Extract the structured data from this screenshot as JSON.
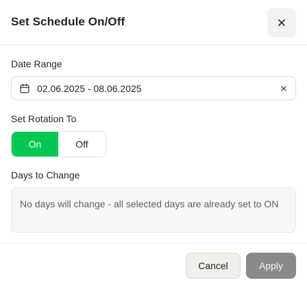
{
  "dialog": {
    "title": "Set Schedule On/Off",
    "close_icon": "close-icon"
  },
  "date_range": {
    "label": "Date Range",
    "value": "02.06.2025 - 08.06.2025",
    "icon": "calendar-icon",
    "clear_icon": "clear-icon"
  },
  "rotation": {
    "label": "Set Rotation To",
    "options": [
      "On",
      "Off"
    ],
    "selected": "On",
    "active_color": "#00c853"
  },
  "days": {
    "label": "Days to Change",
    "message": "No days will change - all selected days are already set to ON"
  },
  "footer": {
    "cancel_label": "Cancel",
    "apply_label": "Apply",
    "apply_color": "#8a8a8a"
  }
}
